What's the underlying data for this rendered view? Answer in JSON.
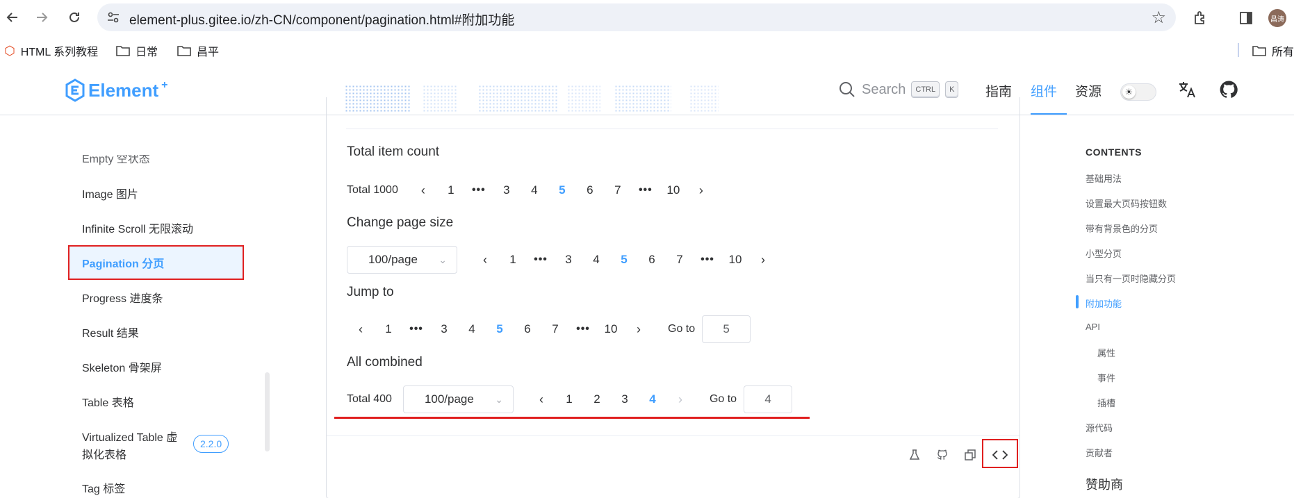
{
  "browser": {
    "url": "element-plus.gitee.io/zh-CN/component/pagination.html#附加功能",
    "bookmarks": [
      "HTML 系列教程",
      "日常",
      "昌平"
    ],
    "all_bookmarks": "所有",
    "avatar_text": "昌涛"
  },
  "header": {
    "logo_text": "Element",
    "logo_sup": "+",
    "search_placeholder": "Search",
    "kbd_ctrl": "CTRL",
    "kbd_k": "K",
    "nav": [
      "指南",
      "组件",
      "资源"
    ],
    "active_nav": "组件",
    "theme_knob": "☀"
  },
  "sidebar": {
    "items": [
      "Empty 空状态",
      "Image 图片",
      "Infinite Scroll 无限滚动",
      "Pagination 分页",
      "Progress 进度条",
      "Result 结果",
      "Skeleton 骨架屏",
      "Table 表格",
      "Virtualized Table 虚",
      "拟化表格",
      "Tag 标签"
    ],
    "active": "Pagination 分页",
    "version_badge": "2.2.0"
  },
  "demo": {
    "sections": [
      "Total item count",
      "Change page size",
      "Jump to",
      "All combined"
    ],
    "total_1000": "Total 1000",
    "total_400": "Total 400",
    "page_size": "100/page",
    "goto_label": "Go to",
    "jump_value": "5",
    "combined_value": "4",
    "pager_a": [
      "1",
      "•••",
      "3",
      "4",
      "5",
      "6",
      "7",
      "•••",
      "10"
    ],
    "pager_b": [
      "1",
      "2",
      "3",
      "4"
    ],
    "prev": "‹",
    "next": "›",
    "chevron": "⌄"
  },
  "toc": {
    "title": "CONTENTS",
    "items": [
      "基础用法",
      "设置最大页码按钮数",
      "带有背景色的分页",
      "小型分页",
      "当只有一页时隐藏分页",
      "附加功能",
      "API",
      "属性",
      "事件",
      "插槽",
      "源代码",
      "贡献者"
    ],
    "active": "附加功能",
    "sponsor": "赞助商"
  },
  "colors": {
    "primary": "#409eff",
    "highlight_red": "#e02020",
    "border": "#dcdfe6"
  }
}
